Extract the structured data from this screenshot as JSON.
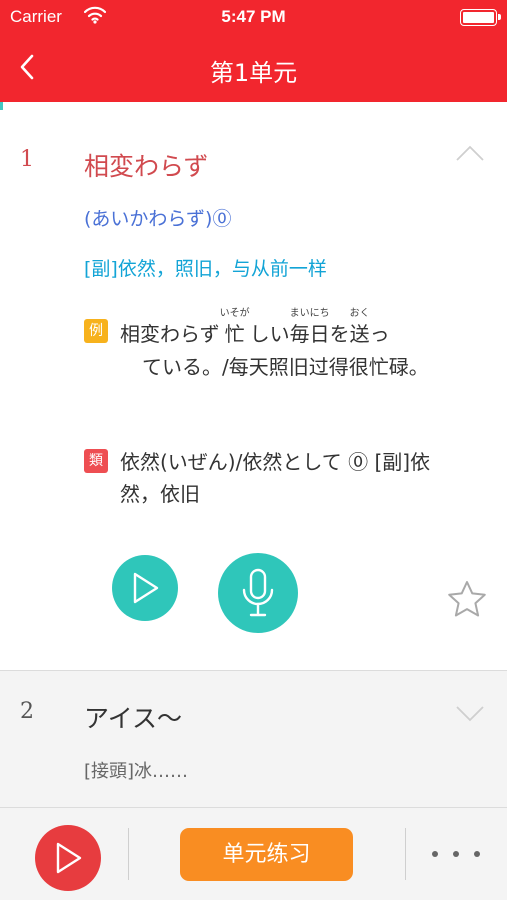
{
  "status": {
    "carrier": "Carrier",
    "time": "5:47 PM",
    "battery_level": 1.0
  },
  "nav": {
    "title": "第1单元",
    "back_icon": "chevron-left-icon"
  },
  "colors": {
    "primary": "#f2262e",
    "teal": "#2fc6ba",
    "orange": "#f98d22",
    "word_red": "#d14a4f",
    "reading_blue": "#4a71d6",
    "meaning_blue": "#13a4d6",
    "example_tag": "#f7b21d",
    "similar_tag": "#ee4e52"
  },
  "entries": [
    {
      "number": "1",
      "word": "相変わらず",
      "reading": "(あいかわらず)⓪",
      "meaning": "[副]依然，照旧，与从前一样",
      "example_tag": "例",
      "example": {
        "part1": "相変わらず",
        "kanji1": "忙",
        "ruby1": "いそが",
        "part2": "しい",
        "kanji2": "毎",
        "ruby2": "まい",
        "kanji3": "日",
        "ruby3": "にち",
        "part3": "を",
        "kanji4": "送",
        "ruby4": "おく",
        "part4": "っ",
        "rest": "ている。/每天照旧过得很忙碌。"
      },
      "similar_tag": "類",
      "similar": "依然(いぜん)/依然として ⓪ [副]依然，依旧",
      "expanded": true
    },
    {
      "number": "2",
      "word": "アイス～",
      "meaning": "[接頭]冰……",
      "expanded": false
    }
  ],
  "bottom": {
    "practice_label": "单元练习",
    "more_icon": "more-dots-icon"
  }
}
